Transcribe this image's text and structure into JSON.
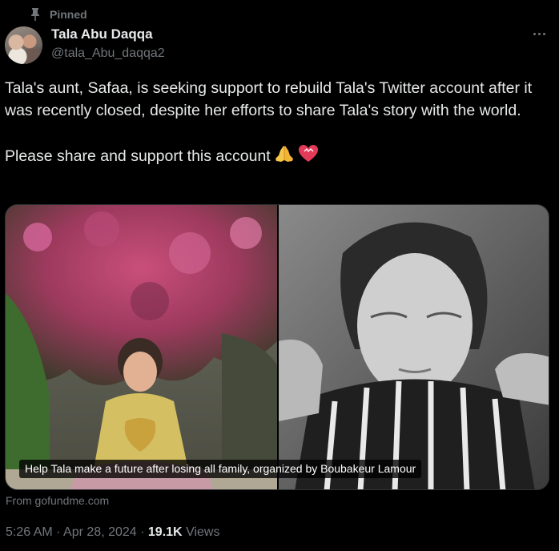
{
  "pinned": {
    "label": "Pinned",
    "icon": "pin-icon"
  },
  "author": {
    "display_name": "Tala Abu Daqqa",
    "handle": "@tala_Abu_daqqa2",
    "avatar": "avatar"
  },
  "tweet": {
    "text_paragraph1": "Tala's aunt, Safaa, is seeking support to rebuild Tala's Twitter account after it was recently closed, despite her efforts to share Tala's story with the world.",
    "text_paragraph2": "Please share and support this account",
    "emojis": [
      "folded-hands-emoji",
      "heart-emoji"
    ]
  },
  "media": {
    "caption": "Help Tala make a future after losing all family, organized by Boubakeur Lamour",
    "source": "From gofundme.com"
  },
  "meta": {
    "time": "5:26 AM",
    "separator": "·",
    "date": "Apr 28, 2024",
    "views_count": "19.1K",
    "views_label": "Views"
  },
  "colors": {
    "background": "#000000",
    "text_primary": "#e7e9ea",
    "text_secondary": "#71767b"
  }
}
